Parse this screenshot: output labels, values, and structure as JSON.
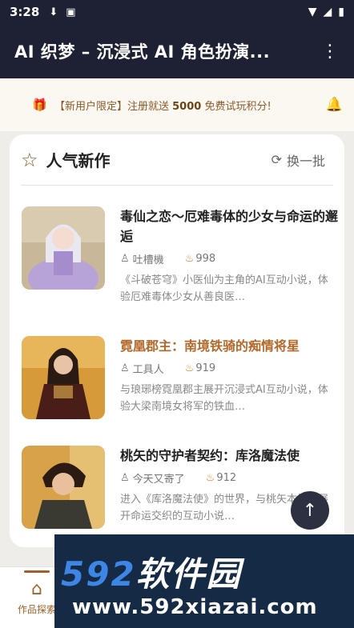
{
  "status_bar": {
    "time": "3:28",
    "icons": [
      "download-icon",
      "a-badge-icon",
      "wifi-icon",
      "signal-icon",
      "battery-icon"
    ]
  },
  "appbar": {
    "title": "AI 织梦 – 沉浸式 AI 角色扮演...",
    "menu_icon": "more-vert-icon"
  },
  "notice": {
    "prefix": "【新用户限定】注册就送 ",
    "amount": "5000",
    "suffix": " 免费试玩积分!"
  },
  "section": {
    "title": "人气新作",
    "refresh_label": "换一批"
  },
  "items": [
    {
      "title": "毒仙之恋～厄难毒体的少女与命运的邂逅",
      "author": "吐槽機",
      "heat": "998",
      "desc": "《斗破苍穹》小医仙为主角的AI互动小说，体验厄难毒体少女从善良医…"
    },
    {
      "title": "霓凰郡主：南境铁骑的痴情将星",
      "author": "工具人",
      "heat": "919",
      "desc": "与琅琊榜霓凰郡主展开沉浸式AI互动小说，体验大梁南境女将军的铁血…"
    },
    {
      "title": "桃矢的守护者契约：库洛魔法使",
      "author": "今天又寄了",
      "heat": "912",
      "desc": "进入《库洛魔法使》的世界，与桃矢本桃矢展开命运交织的互动小说…"
    }
  ],
  "bottom_nav": {
    "explore_label": "作品探索"
  },
  "watermark": {
    "brand_num": "592",
    "brand_text": "软件园",
    "url": "www.592xiazai.com"
  },
  "colors": {
    "appbar": "#1e2133",
    "accent": "#a0622a",
    "highlight_title": "#b4682a"
  }
}
